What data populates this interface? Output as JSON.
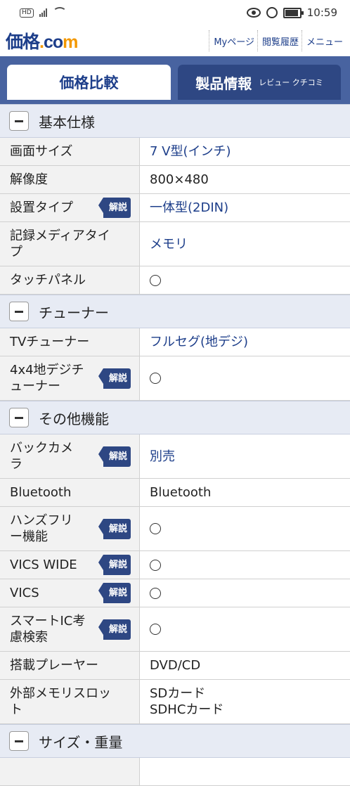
{
  "statusbar": {
    "hd": "HD",
    "time": "10:59"
  },
  "header": {
    "logo_main": "価格",
    "logo_dot": ".",
    "logo_co": "co",
    "logo_m": "m",
    "nav": [
      "Myページ",
      "閲覧履歴",
      "メニュー"
    ]
  },
  "tabs": {
    "active": "価格比較",
    "other": "製品情報",
    "other_sub": "レビュー クチコミ"
  },
  "kaisetsu": "解説",
  "sections": {
    "basic": "基本仕様",
    "tuner": "チューナー",
    "other": "その他機能",
    "size": "サイズ・重量"
  },
  "rows": {
    "screen_size": {
      "label": "画面サイズ",
      "value": "7 V型(インチ)"
    },
    "resolution": {
      "label": "解像度",
      "value": "800×480"
    },
    "install_type": {
      "label": "設置タイプ",
      "value": "一体型(2DIN)"
    },
    "media_type": {
      "label": "記録メディアタイ\nプ",
      "value": "メモリ"
    },
    "touch_panel": {
      "label": "タッチパネル",
      "value": "○"
    },
    "tv_tuner": {
      "label": "TVチューナー",
      "value": "フルセグ(地デジ)"
    },
    "tuner4x4": {
      "label": "4x4地デジチ\nューナー",
      "value": "○"
    },
    "back_camera": {
      "label": "バックカメ\nラ",
      "value": "別売"
    },
    "bluetooth": {
      "label": "Bluetooth",
      "value": "Bluetooth"
    },
    "handsfree": {
      "label": "ハンズフリ\nー機能",
      "value": "○"
    },
    "vics_wide": {
      "label": "VICS WIDE",
      "value": "○"
    },
    "vics": {
      "label": "VICS",
      "value": "○"
    },
    "smart_ic": {
      "label": "スマートIC考\n慮検索",
      "value": "○"
    },
    "player": {
      "label": "搭載プレーヤー",
      "value": "DVD/CD"
    },
    "memory_slot": {
      "label": "外部メモリスロッ\nト",
      "value1": "SDカード",
      "value2": "SDHCカード"
    }
  }
}
